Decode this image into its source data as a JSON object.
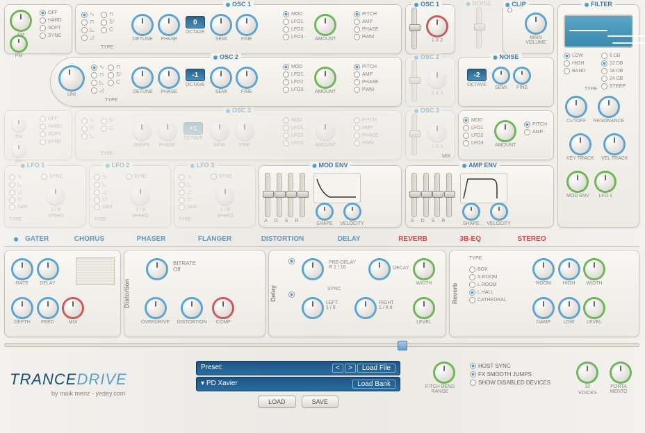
{
  "fm_pm": {
    "fm": "FM",
    "pm": "PM",
    "modes": [
      "OFF",
      "HARD",
      "SOFT",
      "SYNC"
    ]
  },
  "osc": [
    {
      "title": "OSC 1",
      "knobs": [
        "DETUNE",
        "PHASE",
        "OCTAVE",
        "SEMI",
        "FINE"
      ],
      "oct": "0",
      "mods": [
        "MOD",
        "LFO1",
        "LFO2",
        "LFO3"
      ],
      "amount": "AMOUNT",
      "targets": [
        "PITCH",
        "AMP",
        "PHASE",
        "PWM"
      ],
      "type": "TYPE"
    },
    {
      "title": "OSC 2",
      "knobs": [
        "DETUNE",
        "PHASE",
        "OCTAVE",
        "SEMI",
        "FINE"
      ],
      "oct": "-1",
      "mods": [
        "MOD",
        "LFO1",
        "LFO2",
        "LFO3"
      ],
      "amount": "AMOUNT",
      "targets": [
        "PITCH",
        "AMP",
        "PHASE",
        "PWM"
      ],
      "type": "TYPE",
      "uni": "UNI"
    },
    {
      "title": "OSC 3",
      "knobs": [
        "SHAPE",
        "PHASE",
        "OCTAVE",
        "SEMI",
        "FINE"
      ],
      "oct": "+1",
      "mods": [
        "MOD",
        "LFO1",
        "LFO2",
        "LFO3"
      ],
      "amount": "AMOUNT",
      "targets": [
        "PITCH",
        "AMP",
        "PHASE",
        "PWM"
      ],
      "type": "TYPE"
    }
  ],
  "mix": {
    "osc1": "OSC 1",
    "noise_h": "NOISE",
    "clip": "CLIP",
    "knob12": "1 X 2",
    "main": "MAIN VOLUME",
    "osc2": "OSC 2",
    "noise": {
      "title": "NOISE",
      "oct": "-2",
      "labels": [
        "OCTAVE",
        "SEMI",
        "FINE"
      ]
    },
    "knob23": "2 X 3",
    "osc3": "OSC 3",
    "mod": {
      "mods": [
        "MOD",
        "LFO1",
        "LFO2",
        "LFO3"
      ],
      "amount": "AMOUNT",
      "targets": [
        "PITCH",
        "AMP"
      ]
    },
    "knob13": "1 X 3",
    "mixlbl": "MIX"
  },
  "filter": {
    "title": "FILTER",
    "modes": [
      "LOW",
      "HIGH",
      "BAND"
    ],
    "slopes": [
      "6 DB",
      "12 DB",
      "18 DB",
      "24 DB",
      "STEEP"
    ],
    "typelbl": "TYPE",
    "knobs": [
      "CUTOFF",
      "RESONANCE",
      "KEY TRACK",
      "VEL TRACK",
      "MOD ENV",
      "LFO 1"
    ]
  },
  "lfo": [
    {
      "title": "LFO 1",
      "sync": "SYNC",
      "speed": "1 / 8",
      "speedlbl": "SPEED",
      "type": "TYPE",
      "sh": "S&H"
    },
    {
      "title": "LFO 2",
      "sync": "SYNC",
      "speed": "1 / 8",
      "speedlbl": "SPEED",
      "type": "TYPE",
      "sh": "S&H"
    },
    {
      "title": "LFO 3",
      "sync": "SYNC",
      "speed": "1 / 8",
      "speedlbl": "SPEED",
      "type": "TYPE",
      "sh": "S&H"
    }
  ],
  "env": [
    {
      "title": "MOD ENV",
      "adsr": [
        "A",
        "D",
        "S",
        "R"
      ],
      "shape": "SHAPE",
      "vel": "VELOCITY"
    },
    {
      "title": "AMP ENV",
      "adsr": [
        "A",
        "D",
        "S",
        "R"
      ],
      "shape": "SHAPE",
      "vel": "VELOCITY"
    }
  ],
  "fx": {
    "tabs": [
      "GATER",
      "CHORUS",
      "PHASER",
      "FLANGER",
      "DISTORTION",
      "DELAY",
      "REVERB",
      "3B-EQ",
      "STEREO"
    ],
    "active": [
      6,
      8
    ],
    "gater": {
      "knobs": [
        "RATE",
        "DELAY",
        "DEPTH",
        "FEED",
        "MIX"
      ]
    },
    "dist": {
      "label": "Distortion",
      "bitrate": "BITRATE",
      "off": "Off",
      "knobs": [
        "OVERDRIVE",
        "DISTORTION",
        "COMP"
      ]
    },
    "delay": {
      "label": "Delay",
      "predelay": "PRE-DELAY",
      "predelayv": "R 1 / 16",
      "decay": "DECAY",
      "sync": "SYNC",
      "left": "LEFT",
      "leftv": "1 / 8",
      "right": "RIGHT",
      "rightv": "1 / 8 d",
      "width": "WIDTH",
      "level": "LEVEL"
    },
    "reverb": {
      "label": "Reverb",
      "type": "TYPE",
      "types": [
        "BOX",
        "S.ROOM",
        "L.ROOM",
        "L.HALL",
        "CATHEDRAL"
      ],
      "knobs": [
        "ROOM",
        "HIGH",
        "WIDTH",
        "DAMP",
        "LOW",
        "LEVEL"
      ]
    }
  },
  "footer": {
    "brand1": "TRANCE",
    "brand2": "DRIVE",
    "by": "by maik menz - yedey.com",
    "preset": "Preset:",
    "presetName": "PD Xavier",
    "loadFile": "Load File",
    "loadBank": "Load Bank",
    "load": "LOAD",
    "save": "SAVE",
    "pitchbend": "PITCH BEND RANGE",
    "hostSync": "HOST SYNC",
    "fxSmooth": "FX SMOOTH JUMPS",
    "showDis": "SHOW DISABLED DEVICES",
    "voices": "32",
    "voicesLbl": "VOICES",
    "porta": "PORTA MENTO"
  }
}
